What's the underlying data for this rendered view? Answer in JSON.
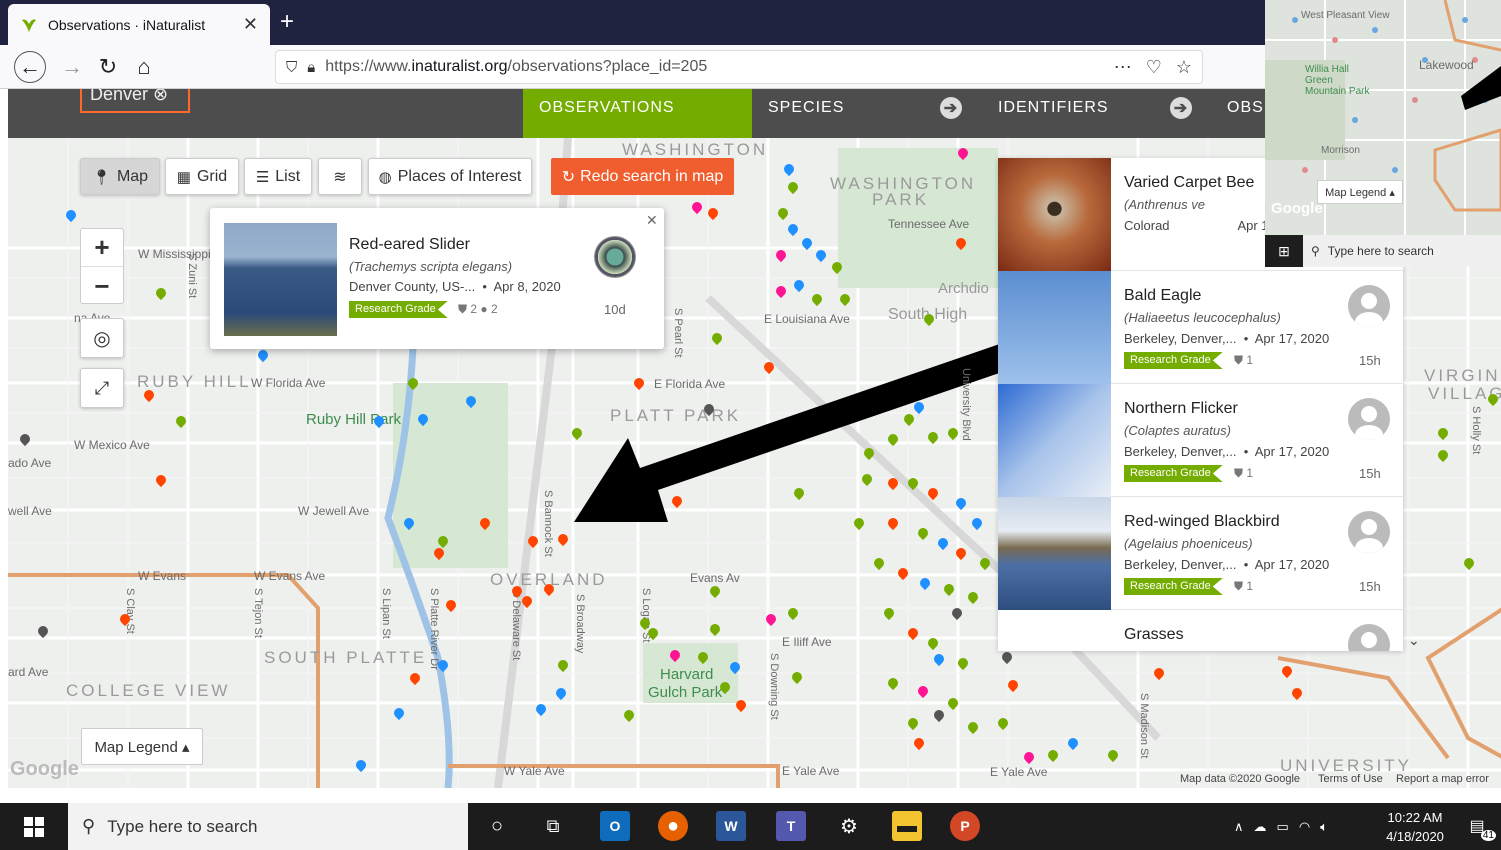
{
  "browser": {
    "tab_title": "Observations · iNaturalist",
    "url_prefix": "https://www.",
    "url_host": "inaturalist.org",
    "url_path": "/observations?place_id=205"
  },
  "header": {
    "place": "Denver",
    "observations_label": "OBSERVATIONS",
    "species_label": "SPECIES",
    "identifiers_label": "IDENTIFIERS",
    "observers_label": "OBS"
  },
  "map_controls": {
    "map": "Map",
    "grid": "Grid",
    "list": "List",
    "places": "Places of Interest",
    "redo": "Redo search in map",
    "legend": "Map Legend ▴"
  },
  "popup": {
    "name": "Red-eared Slider",
    "scientific": "(Trachemys scripta elegans)",
    "place": "Denver County, US-...",
    "date": "Apr 8, 2020",
    "grade": "Research Grade",
    "ids": "2",
    "comments": "2",
    "ago": "10d"
  },
  "observations": [
    {
      "name": "Varied Carpet Bee",
      "scientific": "(Anthrenus ve",
      "place": "Colorad",
      "date": "Apr 17,",
      "grade": "",
      "ids": "",
      "ago": ""
    },
    {
      "name": "Bald Eagle",
      "scientific": "(Haliaeetus leucocephalus)",
      "place": "Berkeley, Denver,...",
      "date": "Apr 17, 2020",
      "grade": "Research Grade",
      "ids": "1",
      "ago": "15h"
    },
    {
      "name": "Northern Flicker",
      "scientific": "(Colaptes auratus)",
      "place": "Berkeley, Denver,...",
      "date": "Apr 17, 2020",
      "grade": "Research Grade",
      "ids": "1",
      "ago": "15h"
    },
    {
      "name": "Red-winged Blackbird",
      "scientific": "(Agelaius phoeniceus)",
      "place": "Berkeley, Denver,...",
      "date": "Apr 17, 2020",
      "grade": "Research Grade",
      "ids": "1",
      "ago": "15h"
    },
    {
      "name": "Grasses",
      "scientific": "",
      "place": "",
      "date": "",
      "grade": "",
      "ids": "",
      "ago": ""
    }
  ],
  "map_labels": {
    "washington": "WASHINGTON",
    "washington_park": "WASHINGTON",
    "park": "PARK",
    "ruby_hill": "RUBY HILL",
    "ruby_hill_park": "Ruby Hill Park",
    "platt_park": "PLATT PARK",
    "overland": "OVERLAND",
    "south_platte": "SOUTH PLATTE",
    "college_view": "COLLEGE VIEW",
    "university": "UNIVERSITY",
    "virginia": "VIRGIN",
    "virginia2": "VILLAG",
    "w_mississippi": "W Mississippi",
    "w_florida": "W Florida Ave",
    "e_florida": "E Florida Ave",
    "w_mexico": "W Mexico Ave",
    "w_jewell": "W Jewell Ave",
    "w_evans": "W Evans",
    "w_evans2": "W Evans Ave",
    "evans_av": "Evans Av",
    "e_louisiana": "E Louisiana Ave",
    "e_iliff": "E Iliff Ave",
    "e_yale": "E Yale Ave",
    "e_yale2": "E Yale Ave",
    "w_yale": "W Yale Ave",
    "tennessee": "Tennessee Ave",
    "south_high": "South High",
    "archdio": "Archdio",
    "harvard": "Harvard",
    "gulch_park": "Gulch Park",
    "ado_ave": "ado Ave",
    "well_ave": "well Ave",
    "ard_ave": "ard Ave",
    "na_ave": "na Ave",
    "s_bannock": "S Bannock St",
    "s_broadway": "S Broadway",
    "s_delaware": "S Delaware St",
    "s_pearl": "S Pearl St",
    "s_logan": "S Logan St",
    "s_downing": "S Downing St",
    "s_zuni": "S Zuni St",
    "s_clay": "S Clay St",
    "s_tejon": "S Tejon St",
    "s_lipan": "S Lipan St",
    "s_platte_river": "S Platte River Dr",
    "s_madison": "S Madison St",
    "university_blvd": "University Blvd",
    "s_holly": "S Holly St"
  },
  "map_footer": {
    "google": "Google",
    "attribution": "Map data ©2020 Google",
    "terms": "Terms of Use",
    "report": "Report a map error"
  },
  "thumb": {
    "labels": [
      "West Pleasant View",
      "Lakewood",
      "Willia Hall Green Mountain Park",
      "Morrison"
    ],
    "legend": "Map Legend ▴",
    "google": "Google",
    "search": "Type here to search"
  },
  "taskbar": {
    "search": "Type here to search",
    "time": "10:22 AM",
    "date": "4/18/2020",
    "notif": "41"
  },
  "colors": {
    "inat_green": "#74ac00",
    "redo_orange": "#f05d2e",
    "header_gray": "#4d4d4d"
  }
}
